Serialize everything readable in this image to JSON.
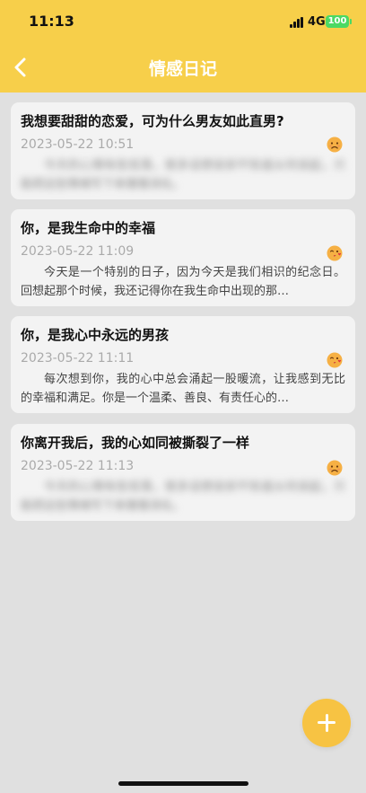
{
  "status_bar": {
    "time": "11:13",
    "network": "4G",
    "battery": "100"
  },
  "header": {
    "title": "情感日记",
    "back_icon": "chevron-left-icon",
    "background_color": "#f7cf4a"
  },
  "entries": [
    {
      "title": "我想要甜甜的恋爱，可为什么男友如此直男?",
      "date": "2023-05-22 10:51",
      "mood": "sad",
      "mood_icon": "sad-face-icon",
      "snippet": "(blurred text)",
      "blurred": true
    },
    {
      "title": "你，是我生命中的幸福",
      "date": "2023-05-22 11:09",
      "mood": "love",
      "mood_icon": "kiss-face-icon",
      "snippet": "今天是一个特别的日子，因为今天是我们相识的纪念日。回想起那个时候，我还记得你在我生命中出现的那…",
      "blurred": false
    },
    {
      "title": "你，是我心中永远的男孩",
      "date": "2023-05-22 11:11",
      "mood": "love",
      "mood_icon": "kiss-face-icon",
      "snippet": "每次想到你，我的心中总会涌起一股暖流，让我感到无比的幸福和满足。你是一个温柔、善良、有责任心的…",
      "blurred": false
    },
    {
      "title": "你离开我后，我的心如同被撕裂了一样",
      "date": "2023-05-22 11:13",
      "mood": "sad",
      "mood_icon": "sad-face-icon",
      "snippet": "(blurred text)",
      "blurred": true
    }
  ],
  "fab": {
    "icon": "plus-icon",
    "color": "#f7c343"
  }
}
